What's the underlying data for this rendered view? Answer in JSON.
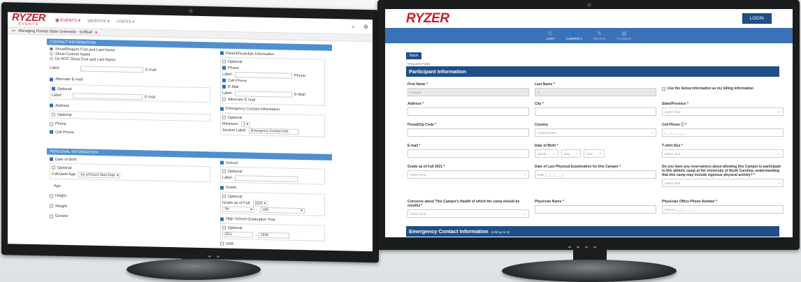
{
  "admin": {
    "logo": "RYZER",
    "logo_sub": "EVENTS",
    "nav": [
      "EVENTS",
      "WEBSITE",
      "USERS"
    ],
    "breadcrumb": "Managing Florida State University - Softball",
    "contact": {
      "header": "CONTACT INFORMATION",
      "name_options": [
        "Show/Require First and Last Name",
        "Show Custom Name",
        "Do NOT Show First and Last Name"
      ],
      "label": "Label:",
      "email": "E-mail",
      "alt_email": "Alternate E-mail",
      "optional": "Optional",
      "address": "Address",
      "phone": "Phone",
      "cell_phone": "Cell Phone",
      "parent_info": "Parent/Guardian Information",
      "emergency": "Emergency Contact Information",
      "minimum": "Minimum:",
      "minimum_value": "2",
      "section_label": "Section Label:",
      "section_label_value": "Emergency Contact Info",
      "e_mail": "E-Mail"
    },
    "personal": {
      "header": "PERSONAL INFORMATION",
      "dob": "Date of Birth",
      "optional": "Optional",
      "calc_age": "Calculate Age:",
      "calc_age_value": "As of Event Start Date",
      "age": "Age",
      "height": "Height",
      "weight": "Weight",
      "gender": "Gender",
      "school": "School",
      "label": "Label:",
      "grade": "Grade",
      "grade_fall": "Grade as of Fall:",
      "grade_fall_value": "2020",
      "grade_from": "7th",
      "grade_to": "12th",
      "hs_grad": "High School Graduation Year",
      "year_from": "2021",
      "year_to": "2026",
      "gpa": "GPA"
    }
  },
  "site": {
    "logo": "RYZER",
    "login": "LOGIN",
    "nav": [
      {
        "icon": "🛒",
        "label": "CART"
      },
      {
        "icon": "👤",
        "label": "CAMPER 1"
      },
      {
        "icon": "✎",
        "label": "REVIEW"
      },
      {
        "icon": "▤",
        "label": "PAYMENT"
      }
    ],
    "back": "Back",
    "required_note": "* Required Fields",
    "participant_header": "Participant Information",
    "emergency_header": "Emergency Contact Information",
    "emergency_note": "(Add up to 3)",
    "fields": {
      "first_name": {
        "label": "First Name *",
        "value": "Camper"
      },
      "last_name": {
        "label": "Last Name *",
        "value": "1"
      },
      "billing": "Use the below information as my billing information",
      "address": {
        "label": "Address *"
      },
      "city": {
        "label": "City *"
      },
      "state": {
        "label": "State/Province *",
        "value": "Select One"
      },
      "postal": {
        "label": "Postal/Zip Code *"
      },
      "country": {
        "label": "Country",
        "value": "United States"
      },
      "cell": {
        "label": "Cell Phone ⓘ *",
        "value": "(___) ___-____"
      },
      "email": {
        "label": "E-mail *"
      },
      "dob": {
        "label": "Date of Birth *",
        "month": "Month",
        "day": "Day",
        "year": "Year"
      },
      "tshirt": {
        "label": "T-shirt Size *",
        "value": "Select One"
      },
      "grade": {
        "label": "Grade as of Fall 2021 *",
        "value": "Select One"
      },
      "physical": {
        "label": "Date of Last Physical Examination for this Camper *",
        "value": "Date (__/__/____)"
      },
      "reservations": {
        "label": "Do you have any reservations about allowing this Camper to participate in this athletic camp at the University of North Carolina, understanding that this camp may include vigorous physical activity? *",
        "value": "Select One"
      },
      "concerns": {
        "label": "Concerns about This Camper's Health of which the camp should be mindful *",
        "value": "Select One"
      },
      "physician": {
        "label": "Physician Name *"
      },
      "physician_phone": {
        "label": "Physician Office Phone Number *",
        "value": "Phone (___) ___-____"
      }
    }
  }
}
